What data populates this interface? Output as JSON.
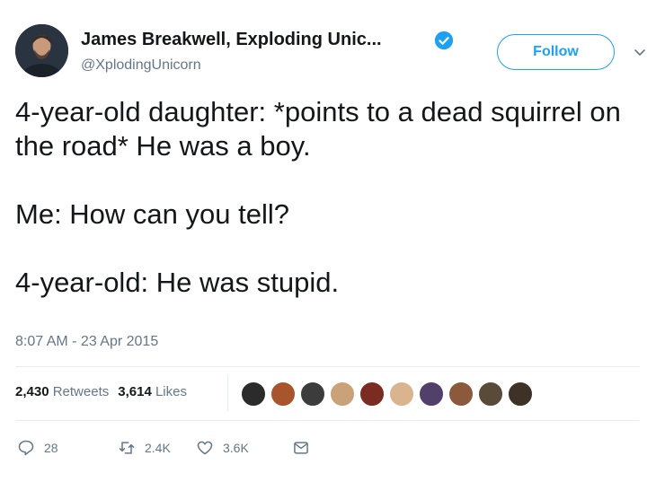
{
  "author": {
    "display_name": "James Breakwell, Exploding Unic...",
    "handle": "@XplodingUnicorn",
    "avatar_icon": "user-avatar",
    "verified_icon": "verified-badge-icon"
  },
  "follow_button": {
    "label": "Follow"
  },
  "tweet": {
    "line1": "4-year-old daughter: *points to a dead squirrel on the road* He was a boy.",
    "line2": "Me: How can you tell?",
    "line3": "4-year-old: He was stupid.",
    "timestamp": "8:07 AM - 23 Apr 2015"
  },
  "stats": {
    "retweets_count": "2,430",
    "retweets_label": "Retweets",
    "likes_count": "3,614",
    "likes_label": "Likes"
  },
  "actions": {
    "replies": "28",
    "retweets": "2.4K",
    "likes": "3.6K"
  },
  "colors": {
    "accent": "#1da1f2",
    "secondary_text": "#657786",
    "divider": "#e6ecf0"
  }
}
